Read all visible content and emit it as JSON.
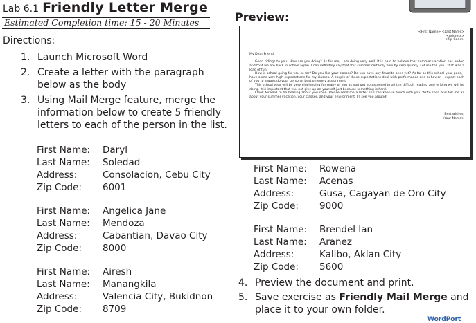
{
  "header": {
    "lab_number": "Lab 6.1",
    "title": "Friendly Letter Merge",
    "estimated_time": "Estimated Completion time: 15 - 20 Minutes"
  },
  "directions_label": "Directions:",
  "steps": [
    {
      "num": "1.",
      "text": "Launch Microsoft Word"
    },
    {
      "num": "2.",
      "text": "Create a letter with the paragraph below as the body"
    },
    {
      "num": "3.",
      "text": "Using Mail Merge feature, merge the information below to create 5 friendly letters to each of the person in the list."
    }
  ],
  "field_labels": {
    "first_name": "First Name:",
    "last_name": "Last Name:",
    "address": "Address:",
    "zip_code": "Zip Code:"
  },
  "records": [
    {
      "first_name": "Daryl",
      "last_name": "Soledad",
      "address": "Consolacion, Cebu City",
      "zip_code": "6001"
    },
    {
      "first_name": "Angelica Jane",
      "last_name": "Mendoza",
      "address": "Cabantian, Davao City",
      "zip_code": "8000"
    },
    {
      "first_name": "Airesh",
      "last_name": "Manangkila",
      "address": "Valencia City, Bukidnon",
      "zip_code": "8709"
    },
    {
      "first_name": "Rowena",
      "last_name": "Acenas",
      "address": "Gusa, Cagayan de Oro City",
      "zip_code": "9000"
    },
    {
      "first_name": "Brendel Ian",
      "last_name": "Aranez",
      "address": "Kalibo, Aklan City",
      "zip_code": "5600"
    }
  ],
  "preview": {
    "label": "Preview:",
    "address_lines": [
      "<First Name> <Last Name>",
      "<Address>",
      "<Zip Code>"
    ],
    "greeting": "My Dear Friend,",
    "para1": "Good tidings to you! How are you doing? As for me, I am doing very well. It is hard to believe that summer vacation has ended and that we are back in school again. I can definitely say that this summer certainly flew by very quickly. Let me tell you...that was a load of fun!",
    "para2": "How is school going for you so far? Do you like your classes? Do you have any favorite ones yet? As far as this school year goes, I have some very high expectations for my classes. A couple of these expectations deal with performance and behavior. I expect each of you to always do your personal best on every assignment.",
    "para3": "This school year will be very challenging for many of you as you get accustomed to all the difficult reading and writing we will be doing. It is important that you not give up on yourself just because something is hard.",
    "para4": "I look forward to be hearing about you soon. Please send me a letter so I can keep in touch with you. Write soon and tell me all about your summer vacation, your classes, and your environment. I'll see you around!",
    "closing": "Best wishes,",
    "signature": "<Your Name>"
  },
  "steps_after": [
    {
      "num": "4.",
      "text": "Preview the document and print."
    },
    {
      "num": "5.",
      "text_before": "Save exercise as ",
      "bold": "Friendly Mail Merge",
      "text_after": " and place it to your own folder."
    }
  ],
  "brand": "WordPort"
}
